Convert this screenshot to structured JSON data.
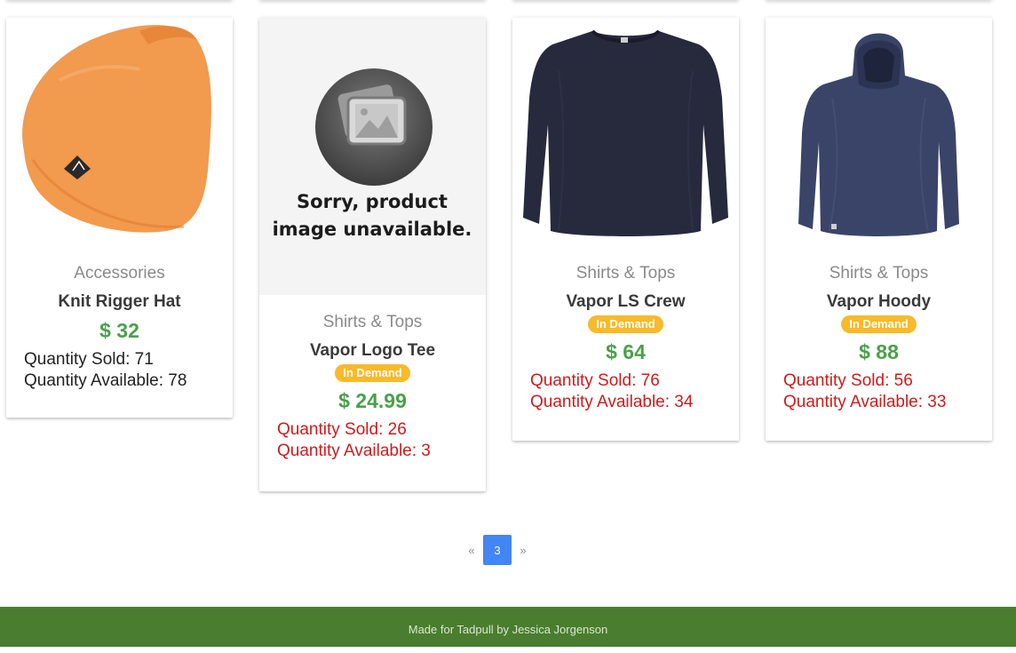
{
  "products": [
    {
      "image": "orange-beanie-image",
      "category": "Accessories",
      "name": "Knit Rigger Hat",
      "in_demand": false,
      "price": "$ 32",
      "sold": "Quantity Sold: 71",
      "available": "Quantity Available: 78"
    },
    {
      "image": "image-unavailable-placeholder",
      "placeholder_line1": "Sorry, product",
      "placeholder_line2": "image unavailable.",
      "category": "Shirts & Tops",
      "name": "Vapor Logo Tee",
      "in_demand": true,
      "badge": "In Demand",
      "price": "$ 24.99",
      "sold": "Quantity Sold: 26",
      "available": "Quantity Available: 3"
    },
    {
      "image": "navy-long-sleeve-image",
      "category": "Shirts & Tops",
      "name": "Vapor LS Crew",
      "in_demand": true,
      "badge": "In Demand",
      "price": "$ 64",
      "sold": "Quantity Sold: 76",
      "available": "Quantity Available: 34"
    },
    {
      "image": "navy-hoody-image",
      "category": "Shirts & Tops",
      "name": "Vapor Hoody",
      "in_demand": true,
      "badge": "In Demand",
      "price": "$ 88",
      "sold": "Quantity Sold: 56",
      "available": "Quantity Available: 33"
    }
  ],
  "pagination": {
    "prev": "«",
    "current": "3",
    "next": "»"
  },
  "footer": {
    "text": "Made for Tadpull by Jessica Jorgenson"
  },
  "colors": {
    "price": "#4aa04a",
    "badge": "#f9b92a",
    "low_stock": "#d11a1a",
    "active_page": "#4285f4",
    "footer_bg": "#4a7d2f"
  }
}
